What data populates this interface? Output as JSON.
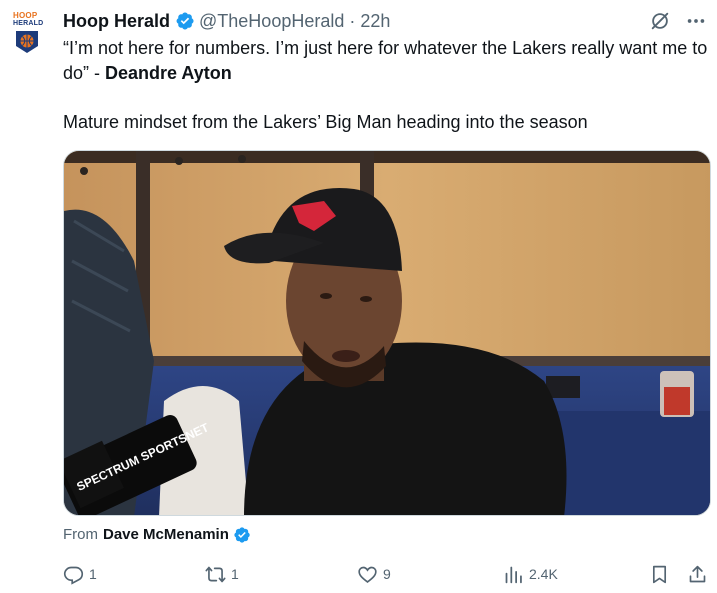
{
  "account": {
    "avatar_text_top": "HOOP",
    "avatar_text_bottom": "HERALD",
    "display_name": "Hoop Herald",
    "handle": "@TheHoopHerald",
    "separator": "·",
    "time": "22h",
    "verified_icon": "verified-badge-icon"
  },
  "tweet": {
    "quote": "“I’m not here for numbers. I’m just here for whatever the Lakers really want me to do” - ",
    "quote_author": "Deandre Ayton",
    "caption": "Mature mindset from the Lakers’ Big Man heading into the season"
  },
  "media": {
    "type": "video-thumbnail",
    "mic_flag_text": "SPECTRUM SPORTSNET"
  },
  "attribution": {
    "prefix": "From",
    "name": "Dave McMenamin"
  },
  "actions": {
    "replies": "1",
    "reposts": "1",
    "likes": "9",
    "views": "2.4K"
  },
  "colors": {
    "text": "#0f1419",
    "secondary": "#536471",
    "verified": "#1d9bf0",
    "avatar_orange": "#e8731f",
    "avatar_navy": "#1d3b7a"
  }
}
